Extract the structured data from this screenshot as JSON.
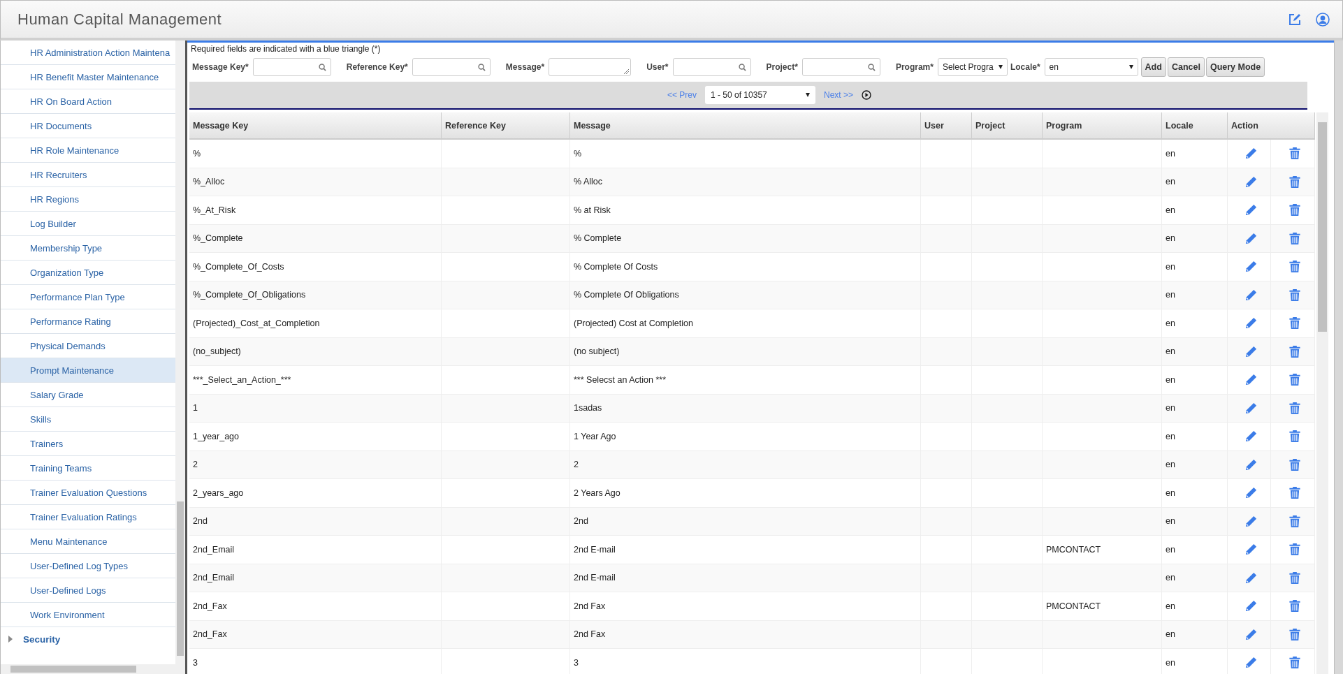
{
  "header": {
    "title": "Human Capital Management"
  },
  "sidebar": {
    "items": [
      {
        "label": "HR Administration Action Maintena",
        "selected": false
      },
      {
        "label": "HR Benefit Master Maintenance",
        "selected": false
      },
      {
        "label": "HR On Board Action",
        "selected": false
      },
      {
        "label": "HR Documents",
        "selected": false
      },
      {
        "label": "HR Role Maintenance",
        "selected": false
      },
      {
        "label": "HR Recruiters",
        "selected": false
      },
      {
        "label": "HR Regions",
        "selected": false
      },
      {
        "label": "Log Builder",
        "selected": false
      },
      {
        "label": "Membership Type",
        "selected": false
      },
      {
        "label": "Organization Type",
        "selected": false
      },
      {
        "label": "Performance Plan Type",
        "selected": false
      },
      {
        "label": "Performance Rating",
        "selected": false
      },
      {
        "label": "Physical Demands",
        "selected": false
      },
      {
        "label": "Prompt Maintenance",
        "selected": true
      },
      {
        "label": "Salary Grade",
        "selected": false
      },
      {
        "label": "Skills",
        "selected": false
      },
      {
        "label": "Trainers",
        "selected": false
      },
      {
        "label": "Training Teams",
        "selected": false
      },
      {
        "label": "Trainer Evaluation Questions",
        "selected": false
      },
      {
        "label": "Trainer Evaluation Ratings",
        "selected": false
      },
      {
        "label": "Menu Maintenance",
        "selected": false
      },
      {
        "label": "User-Defined Log Types",
        "selected": false
      },
      {
        "label": "User-Defined Logs",
        "selected": false
      },
      {
        "label": "Work Environment",
        "selected": false
      }
    ],
    "groups": [
      {
        "label": "Security",
        "expanded": false
      }
    ]
  },
  "form": {
    "note": "Required fields are indicated with a blue triangle (*)",
    "fields": [
      {
        "label": "Message Key*",
        "kind": "search"
      },
      {
        "label": "Reference Key*",
        "kind": "search"
      },
      {
        "label": "Message*",
        "kind": "textarea"
      },
      {
        "label": "User*",
        "kind": "search"
      },
      {
        "label": "Project*",
        "kind": "search"
      },
      {
        "label": "Program*",
        "kind": "select",
        "value": "Select Progra"
      },
      {
        "label": "Locale*",
        "kind": "select",
        "value": "en"
      }
    ],
    "buttons": [
      "Add",
      "Cancel",
      "Query Mode"
    ]
  },
  "pager": {
    "prev": "<< Prev",
    "range": "1 - 50 of 10357",
    "next": "Next >>"
  },
  "table": {
    "columns": [
      "Message Key",
      "Reference Key",
      "Message",
      "User",
      "Project",
      "Program",
      "Locale",
      "Action"
    ],
    "rows": [
      {
        "key": "%",
        "message": "%",
        "locale": "en"
      },
      {
        "key": "%_Alloc",
        "message": "% Alloc",
        "locale": "en"
      },
      {
        "key": "%_At_Risk",
        "message": "% at Risk",
        "locale": "en"
      },
      {
        "key": "%_Complete",
        "message": "% Complete",
        "locale": "en"
      },
      {
        "key": "%_Complete_Of_Costs",
        "message": "% Complete Of Costs",
        "locale": "en"
      },
      {
        "key": "%_Complete_Of_Obligations",
        "message": "% Complete Of Obligations",
        "locale": "en"
      },
      {
        "key": "(Projected)_Cost_at_Completion",
        "message": "(Projected) Cost at Completion",
        "locale": "en"
      },
      {
        "key": "(no_subject)",
        "message": "(no subject)",
        "locale": "en"
      },
      {
        "key": "***_Select_an_Action_***",
        "message": "*** Selecst an Action ***",
        "locale": "en"
      },
      {
        "key": "1",
        "message": "1sadas",
        "locale": "en"
      },
      {
        "key": "1_year_ago",
        "message": "1 Year Ago",
        "locale": "en"
      },
      {
        "key": "2",
        "message": "2",
        "locale": "en"
      },
      {
        "key": "2_years_ago",
        "message": "2 Years Ago",
        "locale": "en"
      },
      {
        "key": "2nd",
        "message": "2nd",
        "locale": "en"
      },
      {
        "key": "2nd_Email",
        "message": "2nd E-mail",
        "program": "PMCONTACT",
        "locale": "en"
      },
      {
        "key": "2nd_Email",
        "message": "2nd E-mail",
        "locale": "en"
      },
      {
        "key": "2nd_Fax",
        "message": "2nd Fax",
        "program": "PMCONTACT",
        "locale": "en"
      },
      {
        "key": "2nd_Fax",
        "message": "2nd Fax",
        "locale": "en"
      },
      {
        "key": "3",
        "message": "3",
        "locale": "en"
      }
    ]
  }
}
